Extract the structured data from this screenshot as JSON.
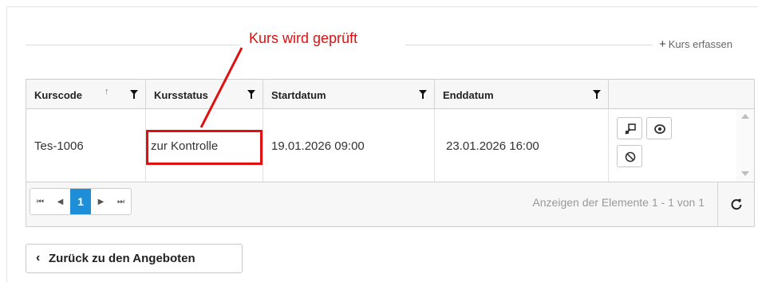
{
  "header": {
    "add_course_label": "Kurs erfassen",
    "add_icon": "plus-icon"
  },
  "table": {
    "columns": [
      {
        "label": "Kurscode",
        "sort": "ascending"
      },
      {
        "label": "Kursstatus"
      },
      {
        "label": "Startdatum"
      },
      {
        "label": "Enddatum"
      }
    ],
    "rows": [
      {
        "kurscode": "Tes-1006",
        "kursstatus": "zur Kontrolle",
        "startdatum": "19.01.2026 09:00",
        "enddatum": "23.01.2026 16:00",
        "actions": [
          "edit-icon",
          "view-icon",
          "cancel-icon"
        ]
      }
    ]
  },
  "pager": {
    "current_page": "1",
    "info": "Anzeigen der Elemente 1 - 1 von 1",
    "icons": [
      "first-page-icon",
      "prev-page-icon",
      "next-page-icon",
      "last-page-icon",
      "refresh-icon"
    ]
  },
  "back_button": {
    "label": "Zurück zu den Angeboten",
    "icon": "chevron-left-icon"
  },
  "annotation": {
    "label": "Kurs wird geprüft",
    "color": "#e01010"
  },
  "colors": {
    "accent": "#1e8ed8",
    "annotation": "#e01010"
  }
}
